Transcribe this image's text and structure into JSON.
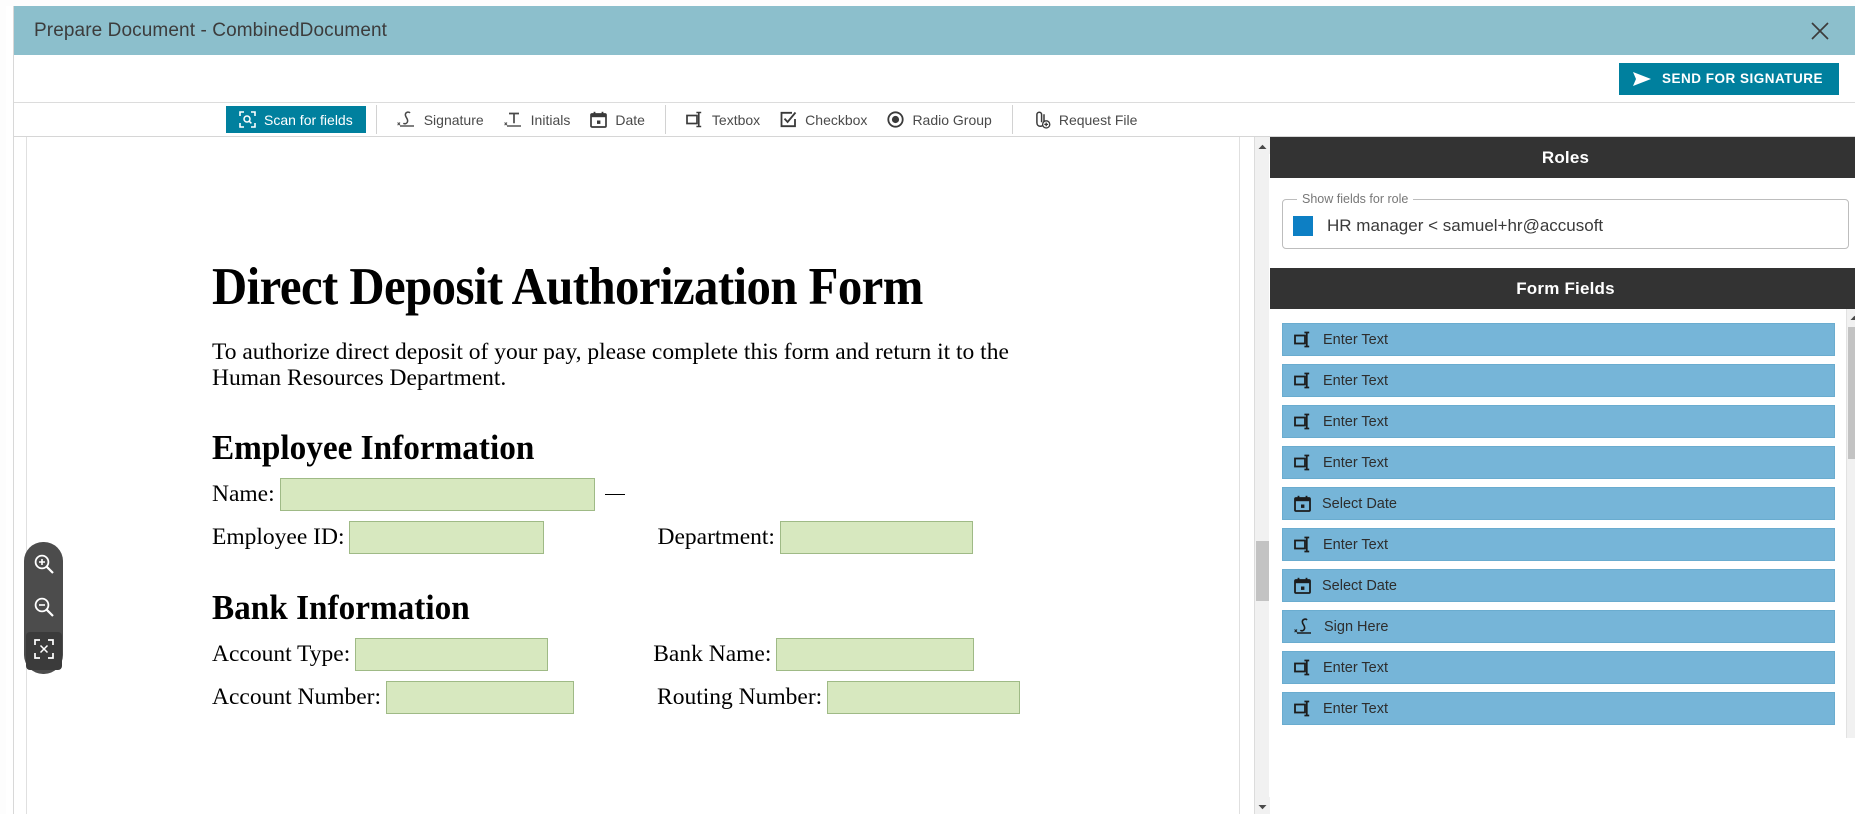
{
  "window": {
    "title": "Prepare Document - CombinedDocument",
    "close_icon": "close-icon"
  },
  "action_bar": {
    "send_label": "SEND FOR SIGNATURE",
    "send_icon": "send-plane-icon",
    "accent_color": "#00809e"
  },
  "toolbar": {
    "groups": [
      {
        "items": [
          {
            "label": "Scan for fields",
            "icon": "scan-fields-icon",
            "primary": true
          }
        ]
      },
      {
        "items": [
          {
            "label": "Signature",
            "icon": "signature-icon",
            "primary": false
          },
          {
            "label": "Initials",
            "icon": "initials-icon",
            "primary": false
          },
          {
            "label": "Date",
            "icon": "calendar-icon",
            "primary": false
          }
        ]
      },
      {
        "items": [
          {
            "label": "Textbox",
            "icon": "textbox-icon",
            "primary": false
          },
          {
            "label": "Checkbox",
            "icon": "checkbox-icon",
            "primary": false
          },
          {
            "label": "Radio Group",
            "icon": "radio-group-icon",
            "primary": false
          }
        ]
      },
      {
        "items": [
          {
            "label": "Request File",
            "icon": "attach-file-plus-icon",
            "primary": false
          }
        ]
      }
    ]
  },
  "document": {
    "title": "Direct Deposit Authorization Form",
    "intro": "To authorize direct deposit of your pay, please complete this form and return it to the Human Resources Department.",
    "sections": [
      {
        "heading": "Employee Information",
        "rows": [
          [
            {
              "label": "Name:",
              "field_width": 315,
              "stub": true
            }
          ],
          [
            {
              "label": "Employee ID:",
              "field_width": 195,
              "stub": false
            },
            {
              "label": "Department:",
              "field_width": 193,
              "stub": false,
              "gap": 113
            }
          ]
        ]
      },
      {
        "heading": "Bank Information",
        "rows": [
          [
            {
              "label": "Account Type:",
              "field_width": 193,
              "stub": false
            },
            {
              "label": "Bank Name:",
              "field_width": 198,
              "stub": false,
              "gap": 105
            }
          ],
          [
            {
              "label": "Account Number:",
              "field_width": 188,
              "stub": false
            },
            {
              "label": "Routing Number:",
              "field_width": 193,
              "stub": false,
              "gap": 83
            }
          ]
        ]
      }
    ],
    "field_fill_color": "#d7e8bf"
  },
  "zoom_controls": {
    "buttons": [
      {
        "name": "zoom-in",
        "icon": "magnifier-plus-icon"
      },
      {
        "name": "zoom-out",
        "icon": "magnifier-minus-icon"
      },
      {
        "name": "fit-page",
        "icon": "fit-page-icon"
      }
    ]
  },
  "right_panel": {
    "roles": {
      "header": "Roles",
      "legend": "Show fields for role",
      "selected_role": "HR manager <  samuel+hr@accusoft",
      "role_color": "#0d7fc4"
    },
    "form_fields": {
      "header": "Form Fields",
      "items": [
        {
          "label": "Enter Text",
          "icon": "textbox-icon"
        },
        {
          "label": "Enter Text",
          "icon": "textbox-icon"
        },
        {
          "label": "Enter Text",
          "icon": "textbox-icon"
        },
        {
          "label": "Enter Text",
          "icon": "textbox-icon"
        },
        {
          "label": "Select Date",
          "icon": "calendar-icon"
        },
        {
          "label": "Enter Text",
          "icon": "textbox-icon"
        },
        {
          "label": "Select Date",
          "icon": "calendar-icon"
        },
        {
          "label": "Sign Here",
          "icon": "signature-icon"
        },
        {
          "label": "Enter Text",
          "icon": "textbox-icon"
        },
        {
          "label": "Enter Text",
          "icon": "textbox-icon"
        }
      ],
      "item_color": "#76b5d8"
    }
  }
}
